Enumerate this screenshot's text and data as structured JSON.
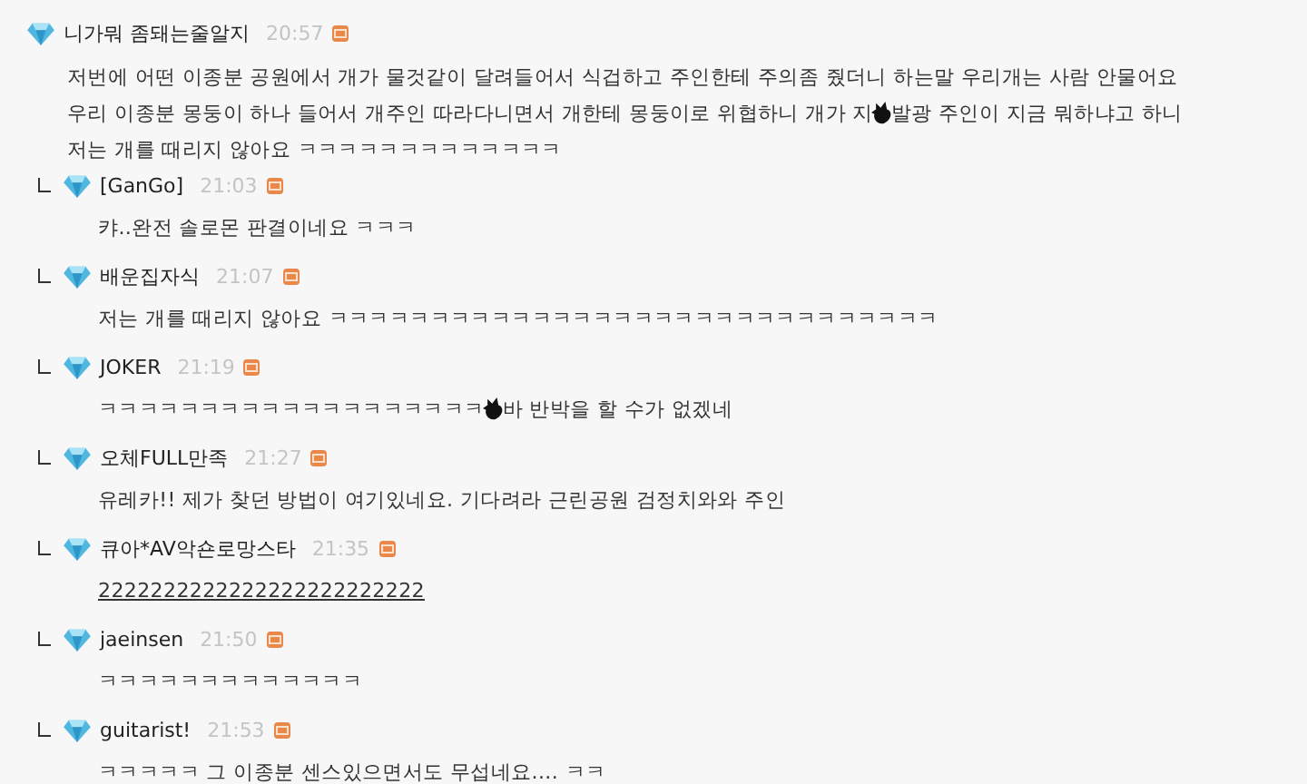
{
  "comment": {
    "author": "니가뭐 좀돼는줄알지",
    "time": "20:57",
    "lines": [
      [
        {
          "kind": "text",
          "text": "저번에 어떤 이종분 공원에서 개가 물것같이 달려들어서 식겁하고 주인한테 주의좀 줬더니 하는말 우리개는 사람 안물어요"
        }
      ],
      [
        {
          "kind": "text",
          "text": "우리 이종분 몽둥이 하나 들어서 개주인 따라다니면서 개한테 몽둥이로 위협하니 개가 지"
        },
        {
          "kind": "blot"
        },
        {
          "kind": "text",
          "text": "발광 주인이 지금 뭐하냐고 하니"
        }
      ],
      [
        {
          "kind": "text",
          "text": "저는 개를 때리지 않아요 ㅋㅋㅋㅋㅋㅋㅋㅋㅋㅋㅋㅋㅋ"
        }
      ]
    ]
  },
  "replies": [
    {
      "author": "[GanGo]",
      "time": "21:03",
      "underlined": false,
      "lines": [
        [
          {
            "kind": "text",
            "text": "캬..완전 솔로몬 판결이네요 ㅋㅋㅋ"
          }
        ]
      ]
    },
    {
      "author": "배운집자식",
      "time": "21:07",
      "underlined": false,
      "lines": [
        [
          {
            "kind": "text",
            "text": "저는 개를 때리지 않아요 ㅋㅋㅋㅋㅋㅋㅋㅋㅋㅋㅋㅋㅋㅋㅋㅋㅋㅋㅋㅋㅋㅋㅋㅋㅋㅋㅋㅋㅋㅋ"
          }
        ]
      ]
    },
    {
      "author": "JOKER",
      "time": "21:19",
      "underlined": false,
      "lines": [
        [
          {
            "kind": "text",
            "text": "ㅋㅋㅋㅋㅋㅋㅋㅋㅋㅋㅋㅋㅋㅋㅋㅋㅋㅋㅋ"
          },
          {
            "kind": "blot"
          },
          {
            "kind": "text",
            "text": "바 반박을 할 수가 없겠네"
          }
        ]
      ]
    },
    {
      "author": "오체FULL만족",
      "time": "21:27",
      "underlined": false,
      "lines": [
        [
          {
            "kind": "text",
            "text": "유레카!! 제가 찾던 방법이 여기있네요. 기다려라 근린공원 검정치와와 주인"
          }
        ]
      ]
    },
    {
      "author": "큐아*AV악숀로망스타",
      "time": "21:35",
      "underlined": true,
      "lines": [
        [
          {
            "kind": "text",
            "text": "2222222222222222222222222"
          }
        ]
      ]
    },
    {
      "author": "jaeinsen",
      "time": "21:50",
      "underlined": false,
      "lines": [
        [
          {
            "kind": "text",
            "text": "ㅋㅋㅋㅋㅋㅋㅋㅋㅋㅋㅋㅋㅋ"
          }
        ]
      ]
    },
    {
      "author": "guitarist!",
      "time": "21:53",
      "underlined": false,
      "lines": [
        [
          {
            "kind": "text",
            "text": "ㅋㅋㅋㅋㅋ 그 이종분 센스있으면서도 무섭네요.... ㅋㅋ"
          }
        ]
      ]
    }
  ]
}
